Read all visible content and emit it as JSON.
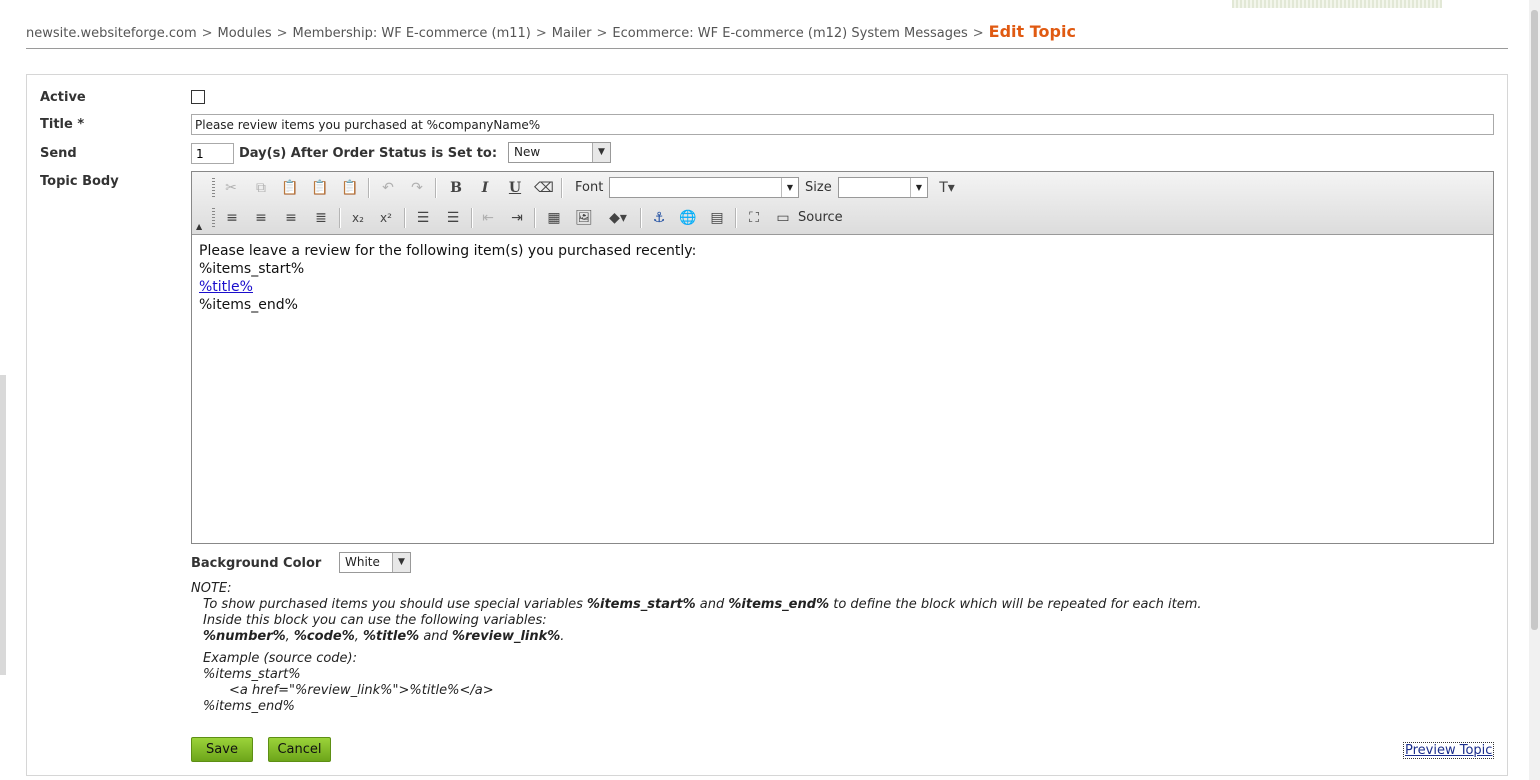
{
  "breadcrumb": {
    "items": [
      "newsite.websiteforge.com",
      "Modules",
      "Membership: WF E-commerce (m11)",
      "Mailer",
      "Ecommerce: WF E-commerce (m12) System Messages"
    ],
    "separator": ">",
    "current": "Edit Topic"
  },
  "form": {
    "active_label": "Active",
    "active_checked": false,
    "title_label": "Title *",
    "title_value": "Please review items you purchased at %companyName%",
    "send_label": "Send",
    "days_value": "1",
    "days_text": "Day(s) After Order Status is Set to:",
    "status_value": "New",
    "topic_body_label": "Topic Body",
    "background_label": "Background Color",
    "background_value": "White"
  },
  "toolbar": {
    "font_label": "Font",
    "size_label": "Size",
    "source_label": "Source",
    "font_value": "",
    "size_value": ""
  },
  "editor": {
    "line1": "Please leave a review for the following item(s) you purchased recently:",
    "line2": "%items_start%",
    "link": "%title%",
    "line4": "%items_end%"
  },
  "note": {
    "heading": "NOTE:",
    "l1_a": "To show purchased items you should use special variables ",
    "l1_b": "%items_start%",
    "l1_c": " and ",
    "l1_d": "%items_end%",
    "l1_e": " to define the block which will be repeated for each item.",
    "l2": "Inside this block you can use the following variables:",
    "v1": "%number%",
    "c1": ", ",
    "v2": "%code%",
    "c2": ", ",
    "v3": "%title%",
    "c3": " and ",
    "v4": "%review_link%",
    "c4": ".",
    "example": "Example (source code):",
    "ex1": "%items_start%",
    "ex2": "<a href=\"%review_link%\">%title%</a>",
    "ex3": "%items_end%"
  },
  "actions": {
    "save": "Save",
    "cancel": "Cancel",
    "preview": "Preview Topic"
  },
  "colors": {
    "accent": "#e05a12",
    "button_green": "#7cb927",
    "link": "#1a0dcc"
  }
}
